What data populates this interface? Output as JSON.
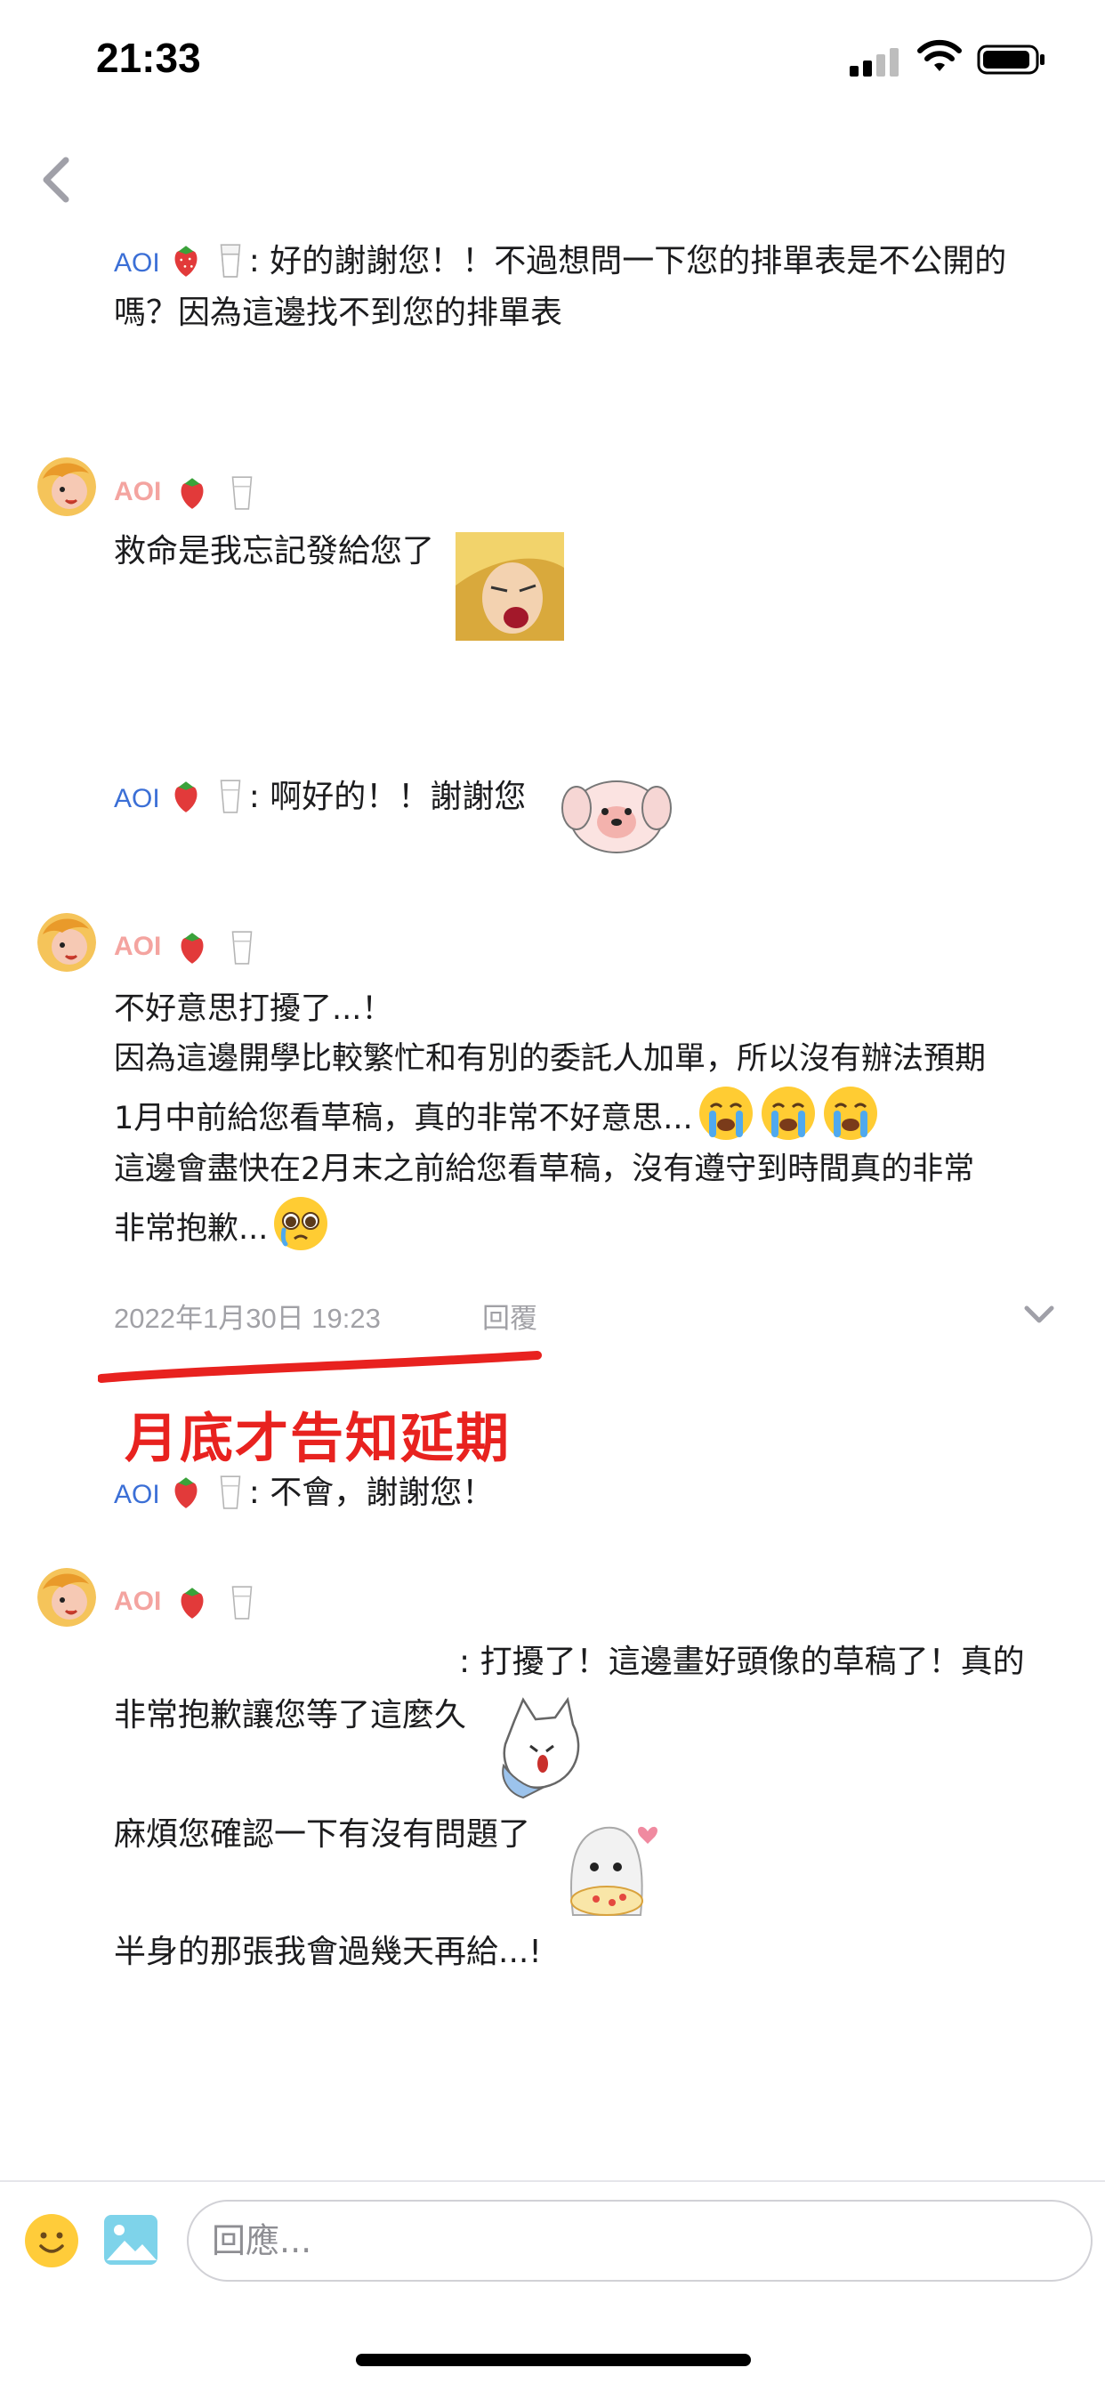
{
  "status_bar": {
    "time": "21:33"
  },
  "messages": {
    "m1_user": "AOI",
    "m1_text_line1": ": 好的謝謝您！！不過想問一下您的排單表是不公開的",
    "m1_text_line2": "嗎？因為這邊找不到您的排單表",
    "m2_user": "AOI",
    "m2_text": "救命是我忘記發給您了",
    "m3_user": "AOI",
    "m3_text": ": 啊好的！！謝謝您",
    "m4_user": "AOI",
    "m4_line1": "不好意思打擾了...！",
    "m4_line2": "因為這邊開學比較繁忙和有別的委託人加單，所以沒有辦法預期",
    "m4_line3": "1月中前給您看草稿，真的非常不好意思...",
    "m4_line4": "這邊會盡快在2月末之前給您看草稿，沒有遵守到時間真的非常",
    "m4_line5": "非常抱歉...",
    "timestamp": "2022年1月30日 19:23",
    "reply_label": "回覆",
    "annotation": "月底才告知延期",
    "m5_user": "AOI",
    "m5_text": ": 不會，謝謝您！",
    "m6_user": "AOI",
    "m6_line1": ": 打擾了！這邊畫好頭像的草稿了！真的",
    "m6_line2": "非常抱歉讓您等了這麼久",
    "m6_line3": "麻煩您確認一下有沒有問題了",
    "m6_line4": "半身的那張我會過幾天再給...!"
  },
  "composer": {
    "placeholder": "回應..."
  },
  "colors": {
    "username_blue": "#3b6fd6",
    "username_pink": "#f4a4a0",
    "annotation_red": "#e8221f"
  },
  "icons": [
    "back-chevron-icon",
    "strawberry-icon",
    "milk-glass-icon",
    "crying-face-icon",
    "pleading-face-icon",
    "smile-icon",
    "image-icon",
    "chevron-down-icon"
  ]
}
